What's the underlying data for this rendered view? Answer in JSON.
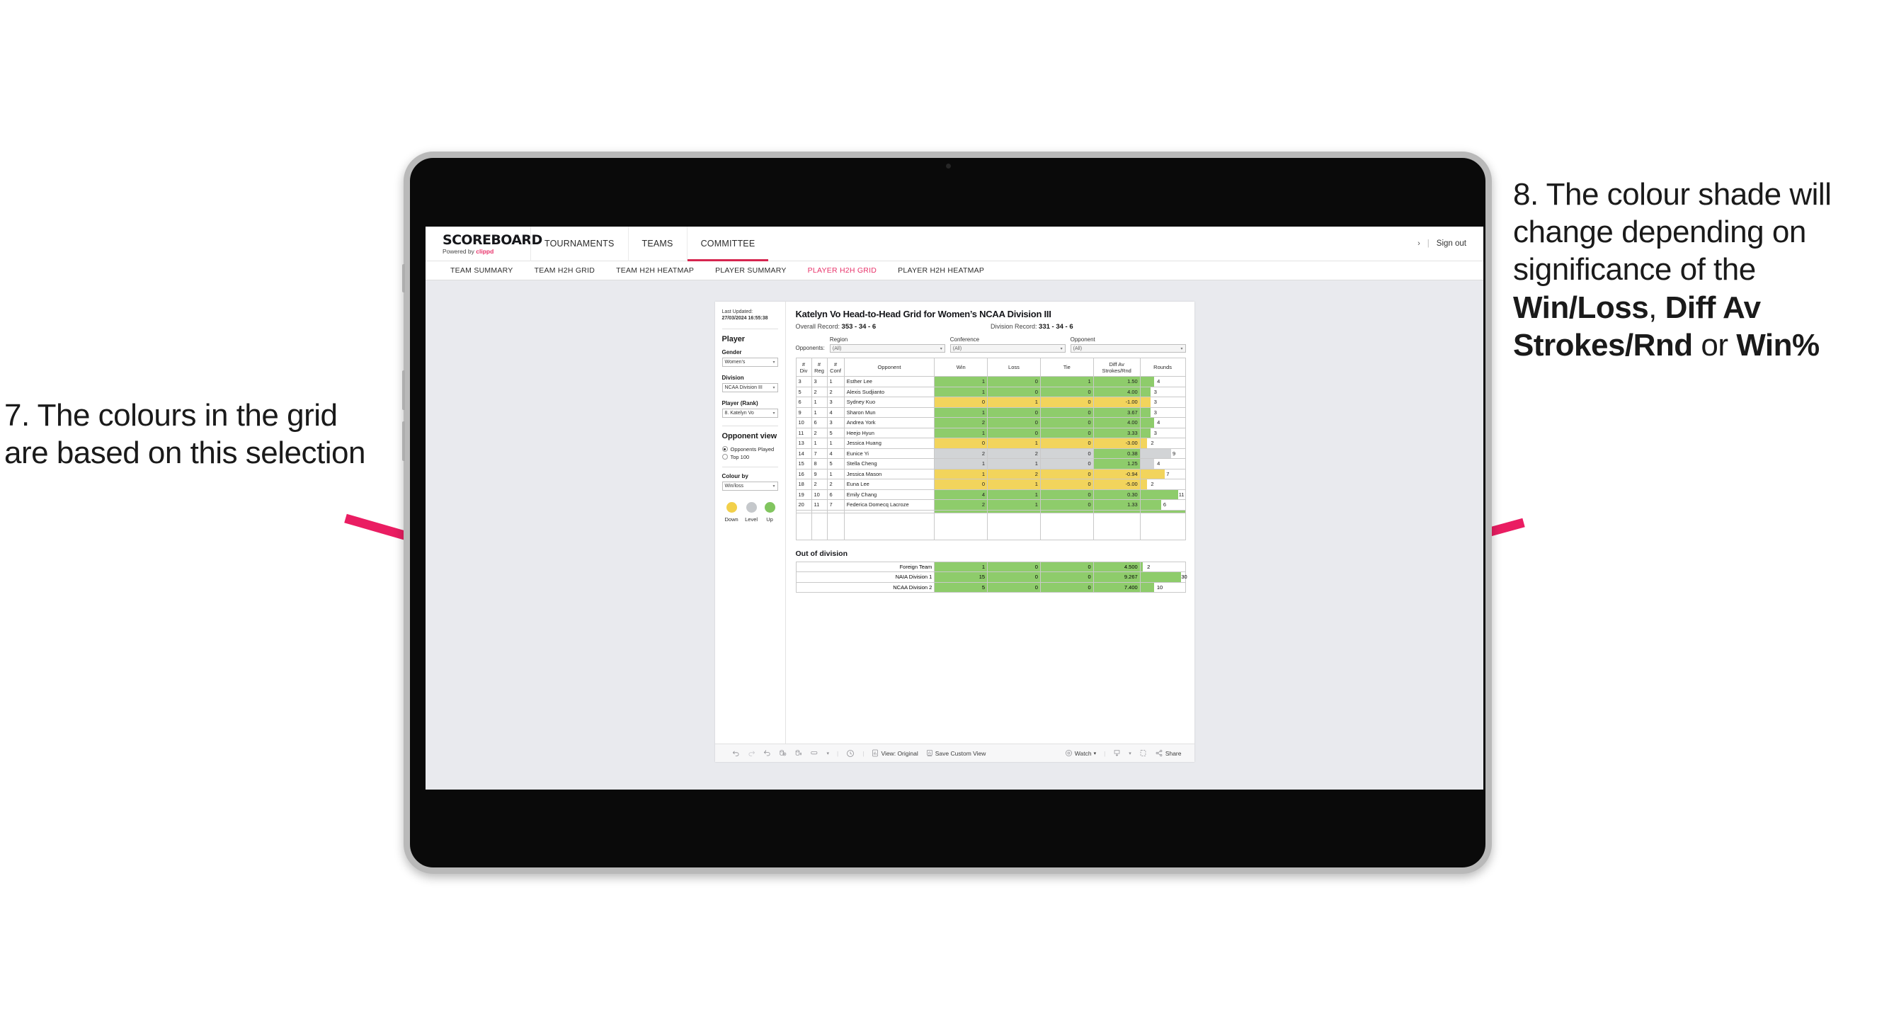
{
  "annotations": {
    "left": {
      "text": "7. The colours in the grid are based on this selection"
    },
    "right": {
      "line1": "8. The colour shade will change depending on significance of the ",
      "bold1": "Win/Loss",
      "mid1": ", ",
      "bold2": "Diff Av Strokes/Rnd",
      "mid2": " or ",
      "bold3": "Win%"
    },
    "arrow_color": "#ea1d62"
  },
  "app": {
    "brand": {
      "logo": "SCOREBOARD",
      "powered_prefix": "Powered by ",
      "powered_name": "clippd"
    },
    "topnav": [
      {
        "label": "TOURNAMENTS",
        "active": false
      },
      {
        "label": "TEAMS",
        "active": false
      },
      {
        "label": "COMMITTEE",
        "active": true
      }
    ],
    "header_right": {
      "chevron": "›",
      "divider": "|",
      "signout": "Sign out"
    },
    "subnav": [
      {
        "label": "TEAM SUMMARY",
        "active": false
      },
      {
        "label": "TEAM H2H GRID",
        "active": false
      },
      {
        "label": "TEAM H2H HEATMAP",
        "active": false
      },
      {
        "label": "PLAYER SUMMARY",
        "active": false
      },
      {
        "label": "PLAYER H2H GRID",
        "active": true
      },
      {
        "label": "PLAYER H2H HEATMAP",
        "active": false
      }
    ]
  },
  "sidebar": {
    "last_updated_label": "Last Updated: ",
    "last_updated_value": "27/03/2024 16:55:38",
    "player_section": "Player",
    "fields": [
      {
        "label": "Gender",
        "value": "Women’s"
      },
      {
        "label": "Division",
        "value": "NCAA Division III"
      },
      {
        "label": "Player (Rank)",
        "value": "8. Katelyn Vo"
      }
    ],
    "opponent_view": {
      "title": "Opponent view",
      "options": [
        {
          "label": "Opponents Played",
          "selected": true
        },
        {
          "label": "Top 100",
          "selected": false
        }
      ]
    },
    "colour_by": {
      "label": "Colour by",
      "value": "Win/loss"
    },
    "legend": [
      {
        "label": "Down",
        "color": "#f2d04b"
      },
      {
        "label": "Level",
        "color": "#c5c8cb"
      },
      {
        "label": "Up",
        "color": "#81c55f"
      }
    ]
  },
  "main": {
    "title": "Katelyn Vo Head-to-Head Grid for Women’s NCAA Division III",
    "overall_record_label": "Overall Record: ",
    "overall_record_value": "353 - 34 - 6",
    "division_record_label": "Division Record: ",
    "division_record_value": "331 - 34 - 6",
    "opponents_label": "Opponents:",
    "filters": [
      {
        "caption": "Region",
        "value": "(All)"
      },
      {
        "caption": "Conference",
        "value": "(All)"
      },
      {
        "caption": "Opponent",
        "value": "(All)"
      }
    ],
    "columns": [
      "# Div",
      "# Reg",
      "# Conf",
      "Opponent",
      "Win",
      "Loss",
      "Tie",
      "Diff Av Strokes/Rnd",
      "Rounds"
    ],
    "out_of_division_title": "Out of division"
  },
  "chart_data": {
    "type": "table",
    "title": "Katelyn Vo Head-to-Head Grid for Women’s NCAA Division III",
    "columns": [
      "#Div",
      "#Reg",
      "#Conf",
      "Opponent",
      "Win",
      "Loss",
      "Tie",
      "Diff Av Strokes/Rnd",
      "Rounds"
    ],
    "rounds_axis_max": 13,
    "rows": [
      {
        "div": "3",
        "reg": "3",
        "conf": "1",
        "opponent": "Esther Lee",
        "win": "1",
        "loss": "0",
        "tie": "1",
        "diff": "1.50",
        "rounds": "4",
        "rounds_value": 4,
        "color": "green"
      },
      {
        "div": "5",
        "reg": "2",
        "conf": "2",
        "opponent": "Alexis Sudjianto",
        "win": "1",
        "loss": "0",
        "tie": "0",
        "diff": "4.00",
        "rounds": "3",
        "rounds_value": 3,
        "color": "green"
      },
      {
        "div": "6",
        "reg": "1",
        "conf": "3",
        "opponent": "Sydney Kuo",
        "win": "0",
        "loss": "1",
        "tie": "0",
        "diff": "-1.00",
        "rounds": "3",
        "rounds_value": 3,
        "color": "yellow"
      },
      {
        "div": "9",
        "reg": "1",
        "conf": "4",
        "opponent": "Sharon Mun",
        "win": "1",
        "loss": "0",
        "tie": "0",
        "diff": "3.67",
        "rounds": "3",
        "rounds_value": 3,
        "color": "green"
      },
      {
        "div": "10",
        "reg": "6",
        "conf": "3",
        "opponent": "Andrea York",
        "win": "2",
        "loss": "0",
        "tie": "0",
        "diff": "4.00",
        "rounds": "4",
        "rounds_value": 4,
        "color": "green"
      },
      {
        "div": "11",
        "reg": "2",
        "conf": "5",
        "opponent": "Heejo Hyun",
        "win": "1",
        "loss": "0",
        "tie": "0",
        "diff": "3.33",
        "rounds": "3",
        "rounds_value": 3,
        "color": "green"
      },
      {
        "div": "13",
        "reg": "1",
        "conf": "1",
        "opponent": "Jessica Huang",
        "win": "0",
        "loss": "1",
        "tie": "0",
        "diff": "-3.00",
        "rounds": "2",
        "rounds_value": 2,
        "color": "yellow"
      },
      {
        "div": "14",
        "reg": "7",
        "conf": "4",
        "opponent": "Eunice Yi",
        "win": "2",
        "loss": "2",
        "tie": "0",
        "diff": "0.38",
        "rounds": "9",
        "rounds_value": 9,
        "color": "grey",
        "diff_color": "green"
      },
      {
        "div": "15",
        "reg": "8",
        "conf": "5",
        "opponent": "Stella Cheng",
        "win": "1",
        "loss": "1",
        "tie": "0",
        "diff": "1.25",
        "rounds": "4",
        "rounds_value": 4,
        "color": "grey",
        "diff_color": "green"
      },
      {
        "div": "16",
        "reg": "9",
        "conf": "1",
        "opponent": "Jessica Mason",
        "win": "1",
        "loss": "2",
        "tie": "0",
        "diff": "-0.94",
        "rounds": "7",
        "rounds_value": 7,
        "color": "yellow"
      },
      {
        "div": "18",
        "reg": "2",
        "conf": "2",
        "opponent": "Euna Lee",
        "win": "0",
        "loss": "1",
        "tie": "0",
        "diff": "-5.00",
        "rounds": "2",
        "rounds_value": 2,
        "color": "yellow"
      },
      {
        "div": "19",
        "reg": "10",
        "conf": "6",
        "opponent": "Emily Chang",
        "win": "4",
        "loss": "1",
        "tie": "0",
        "diff": "0.30",
        "rounds": "11",
        "rounds_value": 11,
        "color": "green"
      },
      {
        "div": "20",
        "reg": "11",
        "conf": "7",
        "opponent": "Federica Domecq Lacroze",
        "win": "2",
        "loss": "1",
        "tie": "0",
        "diff": "1.33",
        "rounds": "6",
        "rounds_value": 6,
        "color": "green"
      }
    ],
    "out_of_division": {
      "title": "Out of division",
      "rows": [
        {
          "label": "Foreign Team",
          "win": "1",
          "loss": "0",
          "tie": "0",
          "diff": "4.500",
          "rounds": "2",
          "rounds_value": 2,
          "color": "green"
        },
        {
          "label": "NAIA Division 1",
          "win": "15",
          "loss": "0",
          "tie": "0",
          "diff": "9.267",
          "rounds": "30",
          "rounds_value": 30,
          "color": "green"
        },
        {
          "label": "NCAA Division 2",
          "win": "5",
          "loss": "0",
          "tie": "0",
          "diff": "7.400",
          "rounds": "10",
          "rounds_value": 10,
          "color": "green"
        }
      ],
      "rounds_axis_max": 33
    },
    "colors": {
      "green": "#8ecc6b",
      "yellow": "#f2d45c",
      "grey": "#d2d4d6"
    }
  },
  "toolbar": {
    "view_label": "View: Original",
    "save_label": "Save Custom View",
    "watch_label": "Watch",
    "share_label": "Share"
  }
}
